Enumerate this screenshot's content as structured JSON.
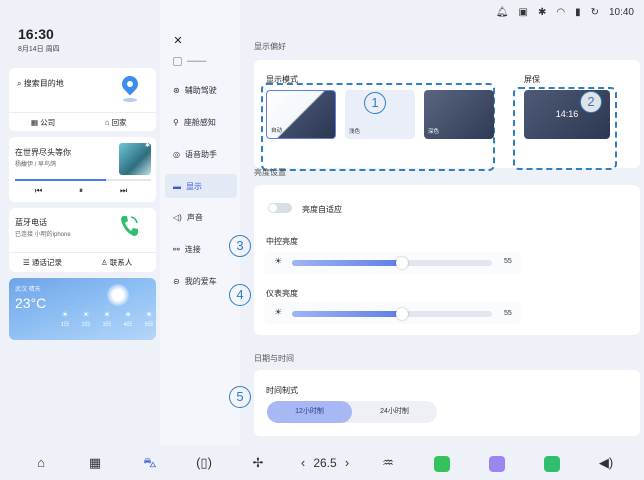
{
  "status_bar": {
    "time": "10:40"
  },
  "left": {
    "time": "16:30",
    "date": "8月14日 周四",
    "nav": {
      "search": "搜索目的地",
      "company": "公司",
      "home": "回家"
    },
    "music": {
      "title": "在世界尽头等你",
      "artist": "杨馥伊 / 早鸟鸽",
      "progress": 0.67
    },
    "phone": {
      "title": "蓝牙电话",
      "subtitle": "已连接 小明的iphone",
      "records": "通话记录",
      "contacts": "联系人"
    },
    "weather": {
      "location": "武汉 晴天",
      "temp": "23°C",
      "days": [
        "1日",
        "2日",
        "3日",
        "4日",
        "5日"
      ]
    }
  },
  "menu": {
    "items": [
      {
        "label": "辅助驾驶",
        "icon": "steering-icon"
      },
      {
        "label": "座舱感知",
        "icon": "sensor-icon"
      },
      {
        "label": "语音助手",
        "icon": "voice-icon"
      },
      {
        "label": "显示",
        "icon": "display-icon"
      },
      {
        "label": "声音",
        "icon": "speaker-icon"
      },
      {
        "label": "连接",
        "icon": "link-icon"
      },
      {
        "label": "我的爱车",
        "icon": "car-icon"
      }
    ],
    "active_index": 3
  },
  "display": {
    "section_title": "显示偏好",
    "mode_title": "显示模式",
    "modes": [
      "自动",
      "浅色",
      "深色"
    ],
    "screensaver_title": "屏保",
    "screensaver_time": "14:16",
    "brightness_title": "亮度设置",
    "auto_brightness": "亮度自适应",
    "center_title": "中控亮度",
    "center_value": "55",
    "center_level": 0.55,
    "cluster_title": "仪表亮度",
    "cluster_value": "55",
    "cluster_level": 0.55,
    "datetime_title": "日期与时间",
    "time_format_title": "时间制式",
    "formats": [
      "12小时制",
      "24小时制"
    ]
  },
  "annotations": [
    "1",
    "2",
    "3",
    "4",
    "5"
  ],
  "bottom": {
    "temperature": "26.5"
  },
  "colors": {
    "accent": "#5d7ee8",
    "annotation": "#2f7fc1"
  }
}
